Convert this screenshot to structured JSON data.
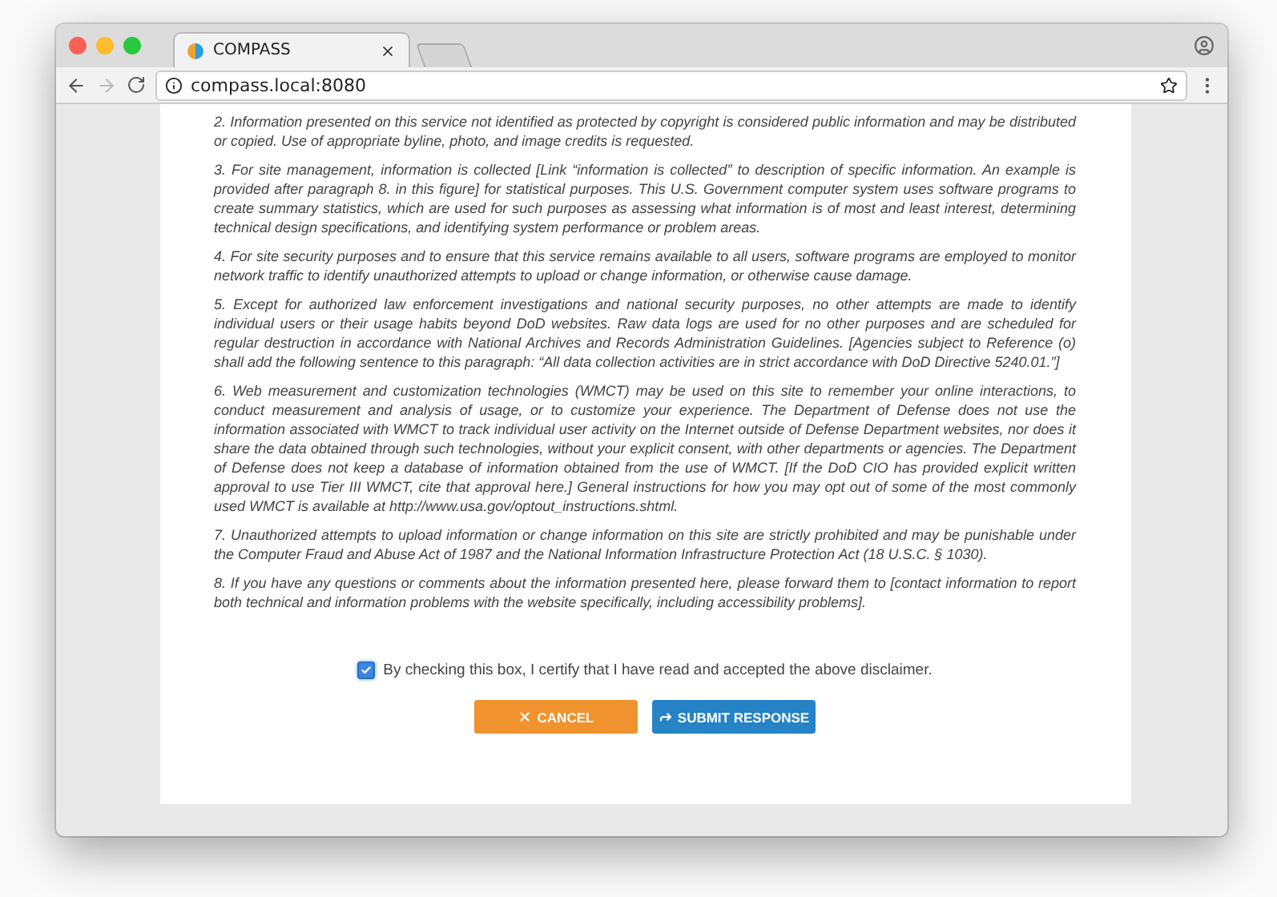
{
  "browser": {
    "tab": {
      "title": "COMPASS",
      "selected": true
    },
    "url": "compass.local:8080"
  },
  "paragraphs": [
    "2. Information presented on this service not identified as protected by copyright is considered public information and may be distributed or copied. Use of appropriate byline, photo, and image credits is requested.",
    "3. For site management, information is collected [Link “information is collected” to description of specific information. An example is provided after paragraph 8. in this figure] for statistical purposes. This U.S. Government computer system uses software programs to create summary statistics, which are used for such purposes as assessing what information is of most and least interest, determining technical design specifications, and identifying system performance or problem areas.",
    "4. For site security purposes and to ensure that this service remains available to all users, software programs are employed to monitor network traffic to identify unauthorized attempts to upload or change information, or otherwise cause damage.",
    "5. Except for authorized law enforcement investigations and national security purposes, no other attempts are made to identify individual users or their usage habits beyond DoD websites. Raw data logs are used for no other purposes and are scheduled for regular destruction in accordance with National Archives and Records Administration Guidelines. [Agencies subject to Reference (o) shall add the following sentence to this paragraph: “All data collection activities are in strict accordance with DoD Directive 5240.01.”]",
    "6. Web measurement and customization technologies (WMCT) may be used on this site to remember your online interactions, to conduct measurement and analysis of usage, or to customize your experience. The Department of Defense does not use the information associated with WMCT to track individual user activity on the Internet outside of Defense Department websites, nor does it share the data obtained through such technologies, without your explicit consent, with other departments or agencies. The Department of Defense does not keep a database of information obtained from the use of WMCT. [If the DoD CIO has provided explicit written approval to use Tier III WMCT, cite that approval here.] General instructions for how you may opt out of some of the most commonly used WMCT is available at http://www.usa.gov/optout_instructions.shtml.",
    "7. Unauthorized attempts to upload information or change information on this site are strictly prohibited and may be punishable under the Computer Fraud and Abuse Act of 1987 and the National Information Infrastructure Protection Act (18 U.S.C. § 1030).",
    "8. If you have any questions or comments about the information presented here, please forward them to [contact information to report both technical and information problems with the website specifically, including accessibility problems]."
  ],
  "agreement": {
    "label": "By checking this box, I certify that I have read and accepted the above disclaimer.",
    "checked": true
  },
  "buttons": [
    {
      "kind": "cancel",
      "label": "CANCEL"
    },
    {
      "kind": "submit",
      "label": "SUBMIT RESPONSE"
    }
  ]
}
